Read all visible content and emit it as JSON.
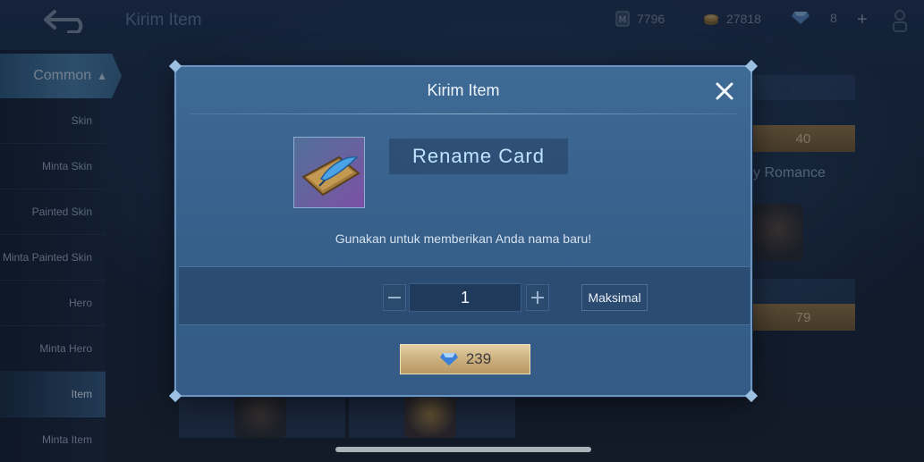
{
  "header": {
    "title": "Kirim Item",
    "currencies": [
      {
        "icon": "ticket-icon",
        "value": "7796"
      },
      {
        "icon": "gold-coin-icon",
        "value": "27818"
      },
      {
        "icon": "diamond-icon",
        "value": "8"
      }
    ]
  },
  "sidebar": {
    "category": "Common",
    "items": [
      {
        "label": "Skin"
      },
      {
        "label": "Minta Skin"
      },
      {
        "label": "Painted Skin"
      },
      {
        "label": "Minta Painted Skin"
      },
      {
        "label": "Hero"
      },
      {
        "label": "Minta Hero"
      },
      {
        "label": "Item"
      },
      {
        "label": "Minta Item"
      }
    ],
    "active_item": "Item"
  },
  "background": {
    "price_top": "40",
    "price_bottom": "79",
    "partial_text": "y Romance"
  },
  "modal": {
    "title": "Kirim Item",
    "item_name": "Rename Card",
    "item_description": "Gunakan untuk memberikan Anda nama baru!",
    "quantity": "1",
    "max_label": "Maksimal",
    "price": "239",
    "price_currency_icon": "diamond-icon"
  },
  "colors": {
    "modal_bg": "#3e6a96",
    "accent_text": "#bfe4ff",
    "buy_button": "#c9ad7a"
  }
}
